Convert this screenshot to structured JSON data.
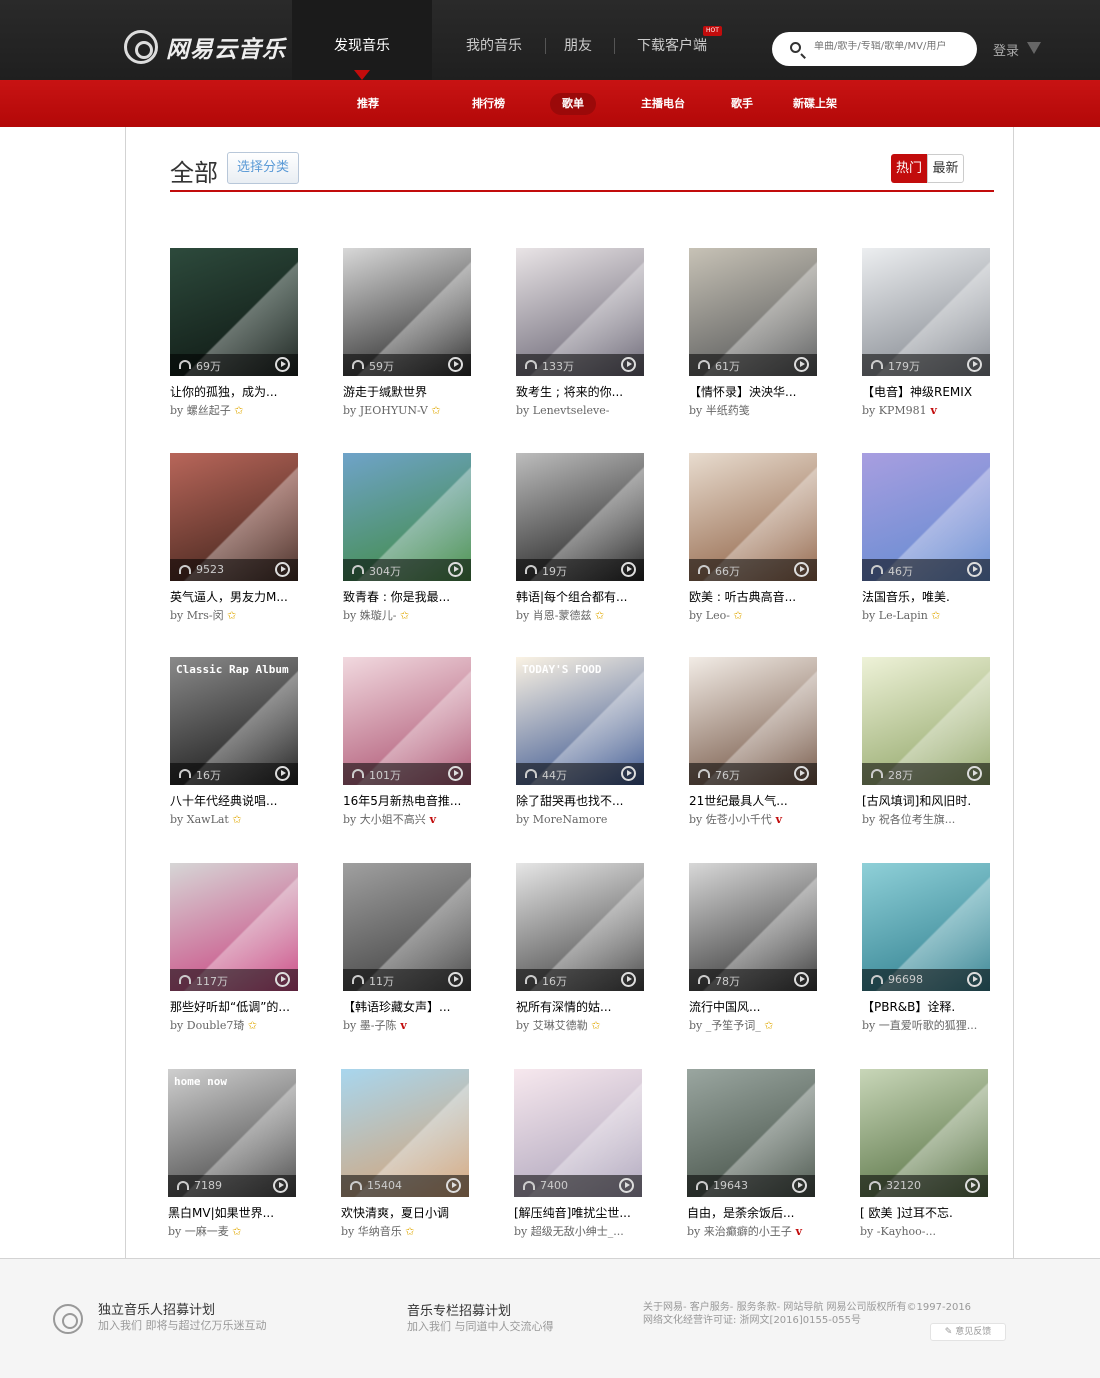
{
  "brand": {
    "name": "网易云音乐"
  },
  "topnav": [
    {
      "label": "发现音乐"
    },
    {
      "label": "我的音乐"
    },
    {
      "label": "朋友"
    },
    {
      "label": "下载客户端",
      "badge": "HOT"
    }
  ],
  "search": {
    "placeholder": "单曲/歌手/专辑/歌单/MV/用户"
  },
  "login": {
    "label": "登录"
  },
  "subnav": [
    {
      "label": "推荐"
    },
    {
      "label": "排行榜"
    },
    {
      "label": "歌单"
    },
    {
      "label": "主播电台"
    },
    {
      "label": "歌手"
    },
    {
      "label": "新碟上架"
    }
  ],
  "page": {
    "title": "全部",
    "choose_label": "选择分类",
    "sort_hot": "热门",
    "sort_new": "最新"
  },
  "colors": {
    "brand_red": "#c20c0c",
    "topbar": "#242424"
  },
  "playlists": [
    {
      "title": "让你的孤独，成为...",
      "count": "69万",
      "author": "螺丝起子",
      "badge": "star",
      "cover_colors": [
        "#2d4a3c",
        "#0c1410"
      ]
    },
    {
      "title": "游走于缄默世界",
      "count": "59万",
      "author": "JEOHYUN-V",
      "badge": "star",
      "cover_colors": [
        "#d8d8d8",
        "#1c1c1c"
      ]
    },
    {
      "title": "致考生 ; 将来的你...",
      "count": "133万",
      "author": "Lenevtseleve-",
      "badge": "",
      "cover_colors": [
        "#e9e4e6",
        "#5e5a6a"
      ]
    },
    {
      "title": "【情怀录】泱泱华...",
      "count": "61万",
      "author": "半纸药笺",
      "badge": "",
      "cover_colors": [
        "#c7c2b6",
        "#4e5052"
      ]
    },
    {
      "title": "【电音】神级REMIX",
      "count": "179万",
      "author": "KPM981",
      "badge": "v",
      "cover_colors": [
        "#eceef0",
        "#7b8088"
      ]
    },
    {
      "title": "英气逼人，男友力M...",
      "count": "9523",
      "author": "Mrs-闵",
      "badge": "star",
      "cover_colors": [
        "#b8665a",
        "#3a2018"
      ]
    },
    {
      "title": "致青春 : 你是我最...",
      "count": "304万",
      "author": "姝璇儿-",
      "badge": "star",
      "cover_colors": [
        "#6fa3c9",
        "#3e8a3c"
      ]
    },
    {
      "title": "韩语|每个组合都有...",
      "count": "19万",
      "author": "肖恩-蒙德兹",
      "badge": "star",
      "cover_colors": [
        "#bdbdbd",
        "#141414"
      ]
    },
    {
      "title": "欧美 : 听古典高音...",
      "count": "66万",
      "author": "Leo-",
      "badge": "star",
      "cover_colors": [
        "#e8dccf",
        "#8a5a3c"
      ]
    },
    {
      "title": "法国音乐，唯美.",
      "count": "46万",
      "author": "Le-Lapin",
      "badge": "star",
      "cover_colors": [
        "#a89ee0",
        "#5f8ad0"
      ]
    },
    {
      "title": "八十年代经典说唱...",
      "count": "16万",
      "author": "XawLat",
      "badge": "star",
      "cover_colors": [
        "#8a8a8a",
        "#101010"
      ],
      "cover_text": "Classic Rap Album"
    },
    {
      "title": "16年5月新热电音推...",
      "count": "101万",
      "author": "大小姐不高兴",
      "badge": "v",
      "cover_colors": [
        "#f1d9df",
        "#a84a6a"
      ]
    },
    {
      "title": "除了甜哭再也找不...",
      "count": "44万",
      "author": "MoreNamore",
      "badge": "",
      "cover_colors": [
        "#fbf3e4",
        "#2c4a8a"
      ],
      "cover_text": "TODAY'S FOOD"
    },
    {
      "title": "21世纪最具人气...",
      "count": "76万",
      "author": "佐苍小小千代",
      "badge": "v",
      "cover_colors": [
        "#f2ece6",
        "#6a4a38"
      ]
    },
    {
      "title": "[古风填词]和风旧时.",
      "count": "28万",
      "author": "祝各位考生旗...",
      "badge": "",
      "cover_colors": [
        "#eef2d8",
        "#8aa060"
      ]
    },
    {
      "title": "那些好听却“低调”的...",
      "count": "117万",
      "author": "Double7琦",
      "badge": "star",
      "cover_colors": [
        "#d6d6d6",
        "#c83a7a"
      ]
    },
    {
      "title": "【韩语珍藏女声】...",
      "count": "11万",
      "author": "墨-子陈",
      "badge": "v",
      "cover_colors": [
        "#a0a0a0",
        "#3a3a3a"
      ]
    },
    {
      "title": "祝所有深情的姑...",
      "count": "16万",
      "author": "艾琳艾德勒",
      "badge": "star",
      "cover_colors": [
        "#e6e6e6",
        "#3a3a3a"
      ]
    },
    {
      "title": "流行中国风...",
      "count": "78万",
      "author": "_予笙予词_",
      "badge": "star",
      "cover_colors": [
        "#d8d8d8",
        "#2a2a2a"
      ]
    },
    {
      "title": "【PBR&B】诠释.",
      "count": "96698",
      "author": "一直爱听歌的狐狸...",
      "badge": "",
      "cover_colors": [
        "#8fd0d8",
        "#2a7a8a"
      ]
    },
    {
      "title": "黑白MV|如果世界...",
      "count": "7189",
      "author": "一麻一麦",
      "badge": "star",
      "cover_colors": [
        "#cfcfcf",
        "#3c3c3c"
      ],
      "cover_text": "home now"
    },
    {
      "title": "欢快清爽，夏日小调",
      "count": "15404",
      "author": "华纳音乐",
      "badge": "star",
      "cover_colors": [
        "#a8d6ee",
        "#d6a070"
      ]
    },
    {
      "title": "[解压纯音]唯扰尘世...",
      "count": "7400",
      "author": "超级无敌小绅士_...",
      "badge": "",
      "cover_colors": [
        "#f7e8ee",
        "#a8a0b8"
      ]
    },
    {
      "title": "自由，是荼余饭后...",
      "count": "19643",
      "author": "来治癫癖的小王子",
      "badge": "v",
      "cover_colors": [
        "#9aa6a0",
        "#3e4a40"
      ]
    },
    {
      "title": "[ 欧美 ]过耳不忘.",
      "count": "32120",
      "author": "-Kayhoo-...",
      "badge": "",
      "cover_colors": [
        "#c8d6b8",
        "#4e6a3a"
      ]
    }
  ],
  "footer": {
    "plan1_title": "独立音乐人招募计划",
    "plan1_sub": "加入我们 即将与超过亿万乐迷互动",
    "plan2_title": "音乐专栏招募计划",
    "plan2_sub": "加入我们 与同道中人交流心得",
    "links_line1": "关于网易- 客户服务- 服务条款- 网站导航  网易公司版权所有©1997-2016",
    "links_line2": "网络文化经营许可证: 浙网文[2016]0155-055号",
    "feedback": "意见反馈"
  }
}
